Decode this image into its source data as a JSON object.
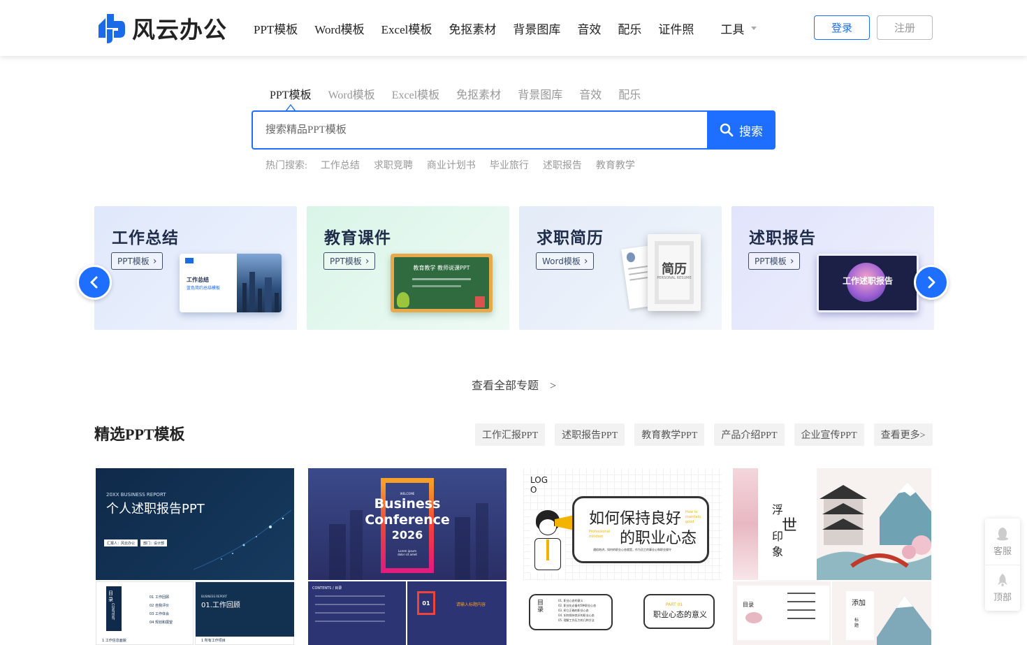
{
  "header": {
    "logo_text": "风云办公",
    "nav": [
      "PPT模板",
      "Word模板",
      "Excel模板",
      "免抠素材",
      "背景图库",
      "音效",
      "配乐",
      "证件照"
    ],
    "tools_label": "工具",
    "login_label": "登录",
    "register_label": "注册"
  },
  "search": {
    "tabs": [
      "PPT模板",
      "Word模板",
      "Excel模板",
      "免抠素材",
      "背景图库",
      "音效",
      "配乐"
    ],
    "placeholder": "搜索精品PPT模板",
    "button_label": "搜索",
    "hot_label": "热门搜索:",
    "hot_items": [
      "工作总结",
      "求职竞聘",
      "商业计划书",
      "毕业旅行",
      "述职报告",
      "教育教学"
    ]
  },
  "carousel": {
    "cards": [
      {
        "title": "工作总结",
        "tag": "PPT模板",
        "bg": "#e4ecfb",
        "thumb_text": "工作总结",
        "thumb_sub": "蓝色简约总结模板"
      },
      {
        "title": "教育课件",
        "tag": "PPT模板",
        "bg": "#e3f6ee",
        "thumb_text": "教育教学 教师说课PPT"
      },
      {
        "title": "求职简历",
        "tag": "Word模板",
        "bg": "#e8eef8",
        "thumb_text": "简历",
        "thumb_sub": "PERSONAL RESUME"
      },
      {
        "title": "述职报告",
        "tag": "PPT模板",
        "bg": "#e6e8fb",
        "thumb_text": "工作述职报告"
      }
    ],
    "view_all": "查看全部专题　>"
  },
  "featured": {
    "title": "精选PPT模板",
    "chips": [
      "工作汇报PPT",
      "述职报告PPT",
      "教育教学PPT",
      "产品介绍PPT",
      "企业宣传PPT",
      "查看更多>"
    ],
    "templates": [
      {
        "kicker": "20XX BUSINESS REPORT",
        "title": "个人述职报告PPT",
        "btn1": "汇报人：风云办公",
        "btn2": "部门：设计部",
        "toc": "目录",
        "toc_en": "CONTENT",
        "toc_items": [
          "01 工作回顾",
          "02 自我评价",
          "03 工作体会",
          "04 规划和展望"
        ],
        "sub_kicker": "BUSINESS REPORT",
        "sub_title": "01.工作回顾",
        "foot1": "1 工作信息面貌",
        "foot2": "1 所有工作项目"
      },
      {
        "kicker": "WELCOME",
        "title1": "Business",
        "title2": "Conference",
        "year": "2026",
        "caption": "Lorem ipsum dolor sit amet",
        "contents": "CONTENTS / 目录",
        "num": "01",
        "red_label": "请输入标题内容"
      },
      {
        "logo": "LOG O",
        "title1": "如何保持良好",
        "title2": "的职业心态",
        "en1": "Professional mindset",
        "en2": "How to maintain good",
        "desc": "通俗地讲，如何的职业心态就是，作为员工的事业心和职业操守",
        "toc": "目录",
        "toc_items": [
          "01. 职业心态的意义",
          "02. 职业化必备的5种职业心态",
          "03. 树立正确的职业心态",
          "04. 如何保持良好的职业心态",
          "05. 理解工作压力的几种方法"
        ],
        "part": "PART 01",
        "part_title": "职业心态的意义"
      },
      {
        "chars": [
          "浮",
          "世",
          "印",
          "象"
        ],
        "toc": "目录",
        "add": "添加",
        "title_sub": "标题"
      }
    ]
  },
  "side": {
    "service": "客服",
    "top": "顶部"
  },
  "colors": {
    "primary": "#1e6fff",
    "dark_navy": "#0f2a4a",
    "brand_blue": "#1b6be8"
  }
}
